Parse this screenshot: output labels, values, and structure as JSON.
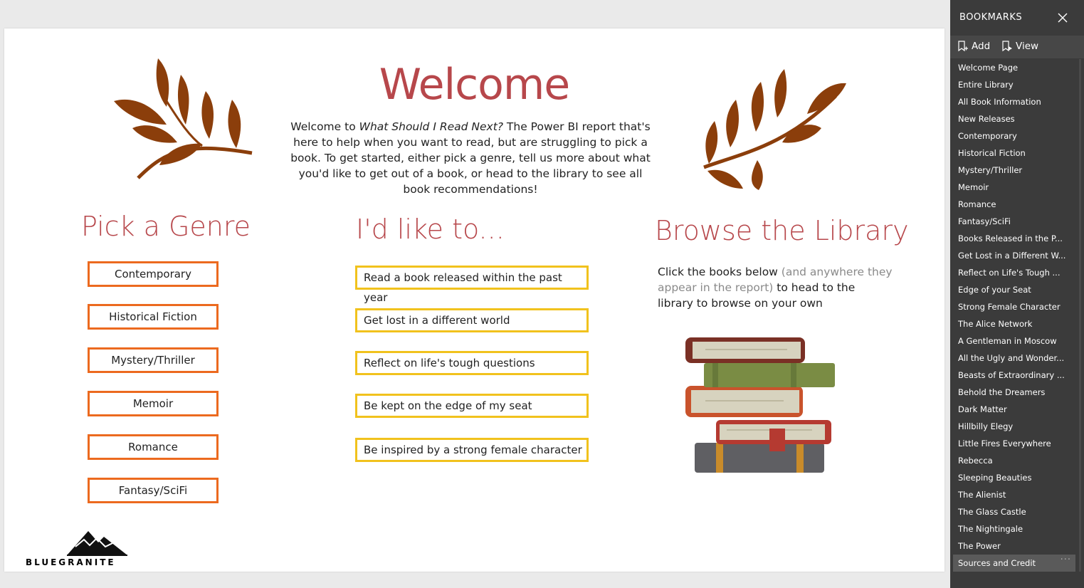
{
  "welcome": {
    "title": "Welcome",
    "intro_prefix": "Welcome to ",
    "intro_italic": "What Should I Read Next?",
    "intro_suffix": " The Power BI report that's here to help when you want to read, but are struggling to pick a book. To get started, either pick a genre, tell us more about what you'd like to get out of a book, or head to the library to see all book recommendations!"
  },
  "genre": {
    "title": "Pick a Genre",
    "buttons": [
      "Contemporary",
      "Historical Fiction",
      "Mystery/Thriller",
      "Memoir",
      "Romance",
      "Fantasy/SciFi"
    ]
  },
  "like": {
    "title": "I'd like to...",
    "buttons": [
      "Read a book released within the past year",
      "Get lost in a different world",
      "Reflect on life's tough questions",
      "Be kept on the edge of my seat",
      "Be inspired by a strong female character"
    ]
  },
  "browse": {
    "title": "Browse the Library",
    "text_1": "Click the books below ",
    "text_muted": "(and anywhere they appear in the report)",
    "text_2": " to head to the library to browse on your own"
  },
  "logo": {
    "text": "BLUEGRANITE"
  },
  "bookmarks": {
    "title": "BOOKMARKS",
    "add_label": "Add",
    "view_label": "View",
    "items": [
      "Welcome Page",
      "Entire Library",
      "All Book Information",
      "New Releases",
      "Contemporary",
      "Historical Fiction",
      "Mystery/Thriller",
      "Memoir",
      "Romance",
      "Fantasy/SciFi",
      "Books Released in the P...",
      "Get Lost in a Different W...",
      "Reflect on Life's Tough ...",
      "Edge of your Seat",
      "Strong Female Character",
      "The Alice Network",
      "A Gentleman in Moscow",
      "All the Ugly and Wonder...",
      "Beasts of Extraordinary ...",
      "Behold the Dreamers",
      "Dark Matter",
      "Hillbilly Elegy",
      "Little Fires Everywhere",
      "Rebecca",
      "Sleeping Beauties",
      "The Alienist",
      "The Glass Castle",
      "The Nightingale",
      "The Power",
      "Sources and Credit"
    ],
    "active_index": 29,
    "more_glyph": "···"
  },
  "colors": {
    "accent_red": "#b7474b",
    "genre_border": "#ec6a1f",
    "like_border": "#f1c21d",
    "leaf": "#8b3e0b",
    "panel_bg": "#3b3b3b"
  }
}
